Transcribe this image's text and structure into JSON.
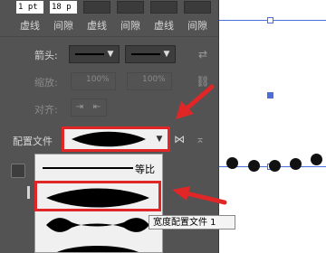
{
  "dash": {
    "values": [
      "1 pt",
      "18 p",
      "",
      "",
      "",
      ""
    ],
    "labels": [
      "虚线",
      "间隙",
      "虚线",
      "间隙",
      "虚线",
      "间隙"
    ]
  },
  "arrows": {
    "label": "箭头:"
  },
  "scale": {
    "label": "缩放:",
    "start": "100%",
    "end": "100%"
  },
  "align": {
    "label": "对齐:"
  },
  "profile": {
    "label": "配置文件",
    "options": [
      {
        "label": "等比"
      },
      {
        "label": ""
      },
      {
        "label": ""
      }
    ],
    "tooltip": "宽度配置文件 1"
  },
  "canvas": {
    "status_value": "1"
  },
  "colors": {
    "accent": "#e02626",
    "panel": "#535353",
    "guide": "#4a6fd8"
  }
}
